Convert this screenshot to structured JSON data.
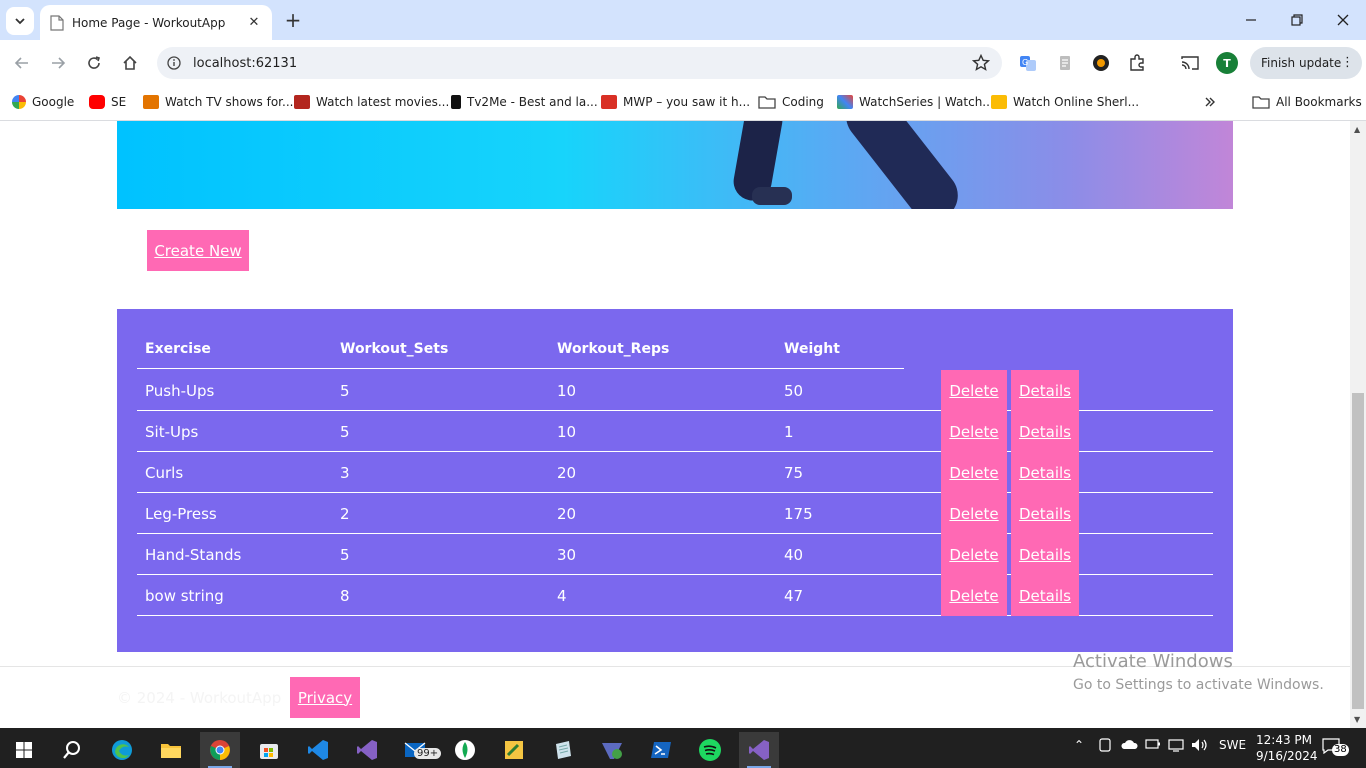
{
  "browser": {
    "tab_title": "Home Page - WorkoutApp",
    "url": "localhost:62131",
    "finish_update_label": "Finish update",
    "profile_initial": "T",
    "bookmarks": [
      {
        "label": "Google",
        "icon": "google-icon"
      },
      {
        "label": "SE",
        "icon": "youtube-icon"
      },
      {
        "label": "Watch TV shows for...",
        "icon": "tv-icon"
      },
      {
        "label": "Watch latest movies...",
        "icon": "movie-icon"
      },
      {
        "label": "Tv2Me - Best and la...",
        "icon": "tv2me-icon"
      },
      {
        "label": "MWP – you saw it h...",
        "icon": "mwp-icon"
      },
      {
        "label": "Coding",
        "icon": "folder-icon"
      },
      {
        "label": "WatchSeries | Watch...",
        "icon": "watchseries-icon"
      },
      {
        "label": "Watch Online Sherl...",
        "icon": "sherlock-icon"
      }
    ],
    "all_bookmarks_label": "All Bookmarks"
  },
  "page": {
    "create_new_label": "Create New",
    "table": {
      "headers": [
        "Exercise",
        "Workout_Sets",
        "Workout_Reps",
        "Weight"
      ],
      "delete_label": "Delete",
      "details_label": "Details",
      "rows": [
        {
          "exercise": "Push-Ups",
          "sets": "5",
          "reps": "10",
          "weight": "50"
        },
        {
          "exercise": "Sit-Ups",
          "sets": "5",
          "reps": "10",
          "weight": "1"
        },
        {
          "exercise": "Curls",
          "sets": "3",
          "reps": "20",
          "weight": "75"
        },
        {
          "exercise": "Leg-Press",
          "sets": "2",
          "reps": "20",
          "weight": "175"
        },
        {
          "exercise": "Hand-Stands",
          "sets": "5",
          "reps": "30",
          "weight": "40"
        },
        {
          "exercise": "bow string",
          "sets": "8",
          "reps": "4",
          "weight": "47"
        }
      ]
    },
    "footer": {
      "copyright": "© 2024 - WorkoutApp",
      "privacy_label": "Privacy"
    },
    "watermark": {
      "title": "Activate Windows",
      "subtitle": "Go to Settings to activate Windows."
    }
  },
  "taskbar": {
    "mail_badge": "99+",
    "language": "SWE",
    "time": "12:43 PM",
    "date": "9/16/2024",
    "notification_count": "38"
  },
  "colors": {
    "table_bg": "#7b68ee",
    "button_pink": "#ff69b4",
    "titlebar": "#d3e3fd"
  }
}
